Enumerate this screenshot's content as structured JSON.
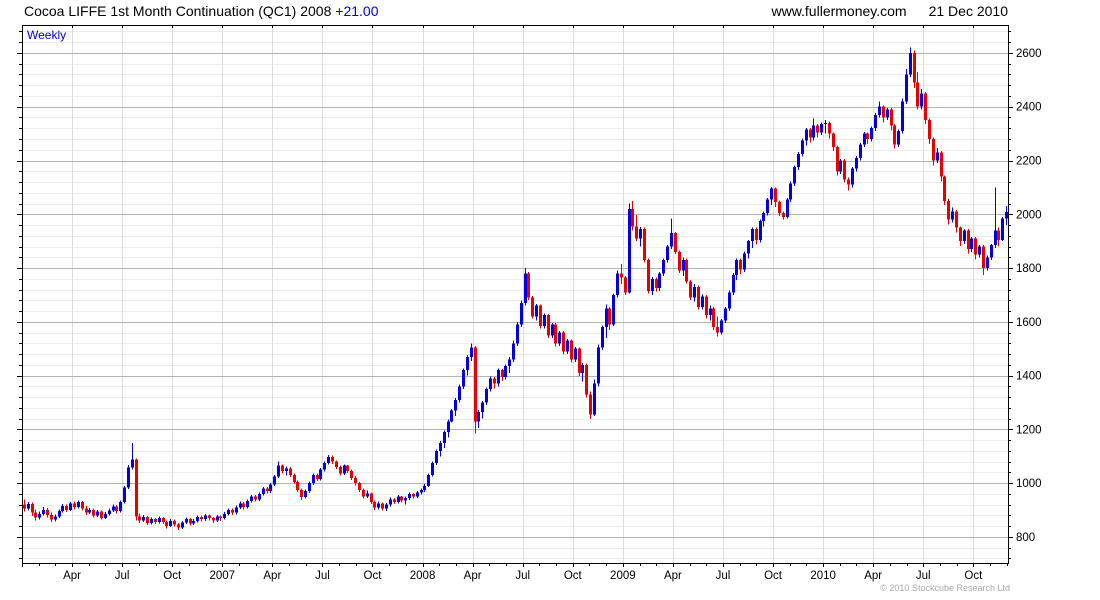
{
  "header": {
    "title": "Cocoa LIFFE 1st Month Continuation (QC1) 2008",
    "change": "+21.00",
    "change_color": "#0000cc",
    "website": "www.fullermoney.com",
    "date": "21 Dec 2010"
  },
  "chart": {
    "frequency_label": "Weekly",
    "footer_credit": "© 2010 Stockcube Research Ltd"
  },
  "chart_data": {
    "type": "candlestick",
    "instrument": "Cocoa LIFFE 1st Month Continuation (QC1)",
    "frequency": "Weekly",
    "last_price": 2008,
    "change": 21.0,
    "x_start": "Jan 2006",
    "x_end": "Dec 2010",
    "x_tick_labels": [
      "Apr",
      "Jul",
      "Oct",
      "2007",
      "Apr",
      "Jul",
      "Oct",
      "2008",
      "Apr",
      "Jul",
      "Oct",
      "2009",
      "Apr",
      "Jul",
      "Oct",
      "2010",
      "Apr",
      "Jul",
      "Oct"
    ],
    "x_tick_weeks": [
      13,
      26,
      39,
      52,
      65,
      78,
      91,
      104,
      117,
      130,
      143,
      156,
      169,
      182,
      195,
      208,
      221,
      234,
      247
    ],
    "weeks_per_month": 4.3333,
    "y_tick_values": [
      800,
      1000,
      1200,
      1400,
      1600,
      1800,
      2000,
      2200,
      2400,
      2600
    ],
    "y_minor_step": 40,
    "ylim": [
      703,
      2704
    ],
    "grid": {
      "major_color": "#b3b3b3",
      "minor_color": "#ececec",
      "vertical_color": "#dcdcdc"
    },
    "up_color": "#0000e0",
    "down_color": "#e60000",
    "ohlc": [
      [
        920,
        940,
        895,
        905
      ],
      [
        905,
        930,
        898,
        922
      ],
      [
        922,
        928,
        878,
        890
      ],
      [
        890,
        902,
        862,
        872
      ],
      [
        872,
        895,
        865,
        886
      ],
      [
        886,
        912,
        880,
        900
      ],
      [
        900,
        908,
        872,
        881
      ],
      [
        881,
        890,
        855,
        864
      ],
      [
        864,
        884,
        858,
        876
      ],
      [
        876,
        902,
        870,
        896
      ],
      [
        896,
        922,
        890,
        915
      ],
      [
        915,
        920,
        892,
        901
      ],
      [
        901,
        930,
        896,
        924
      ],
      [
        924,
        932,
        902,
        911
      ],
      [
        911,
        936,
        905,
        929
      ],
      [
        929,
        934,
        898,
        906
      ],
      [
        906,
        915,
        882,
        891
      ],
      [
        891,
        908,
        885,
        901
      ],
      [
        901,
        906,
        872,
        880
      ],
      [
        880,
        900,
        874,
        895
      ],
      [
        895,
        898,
        864,
        871
      ],
      [
        871,
        892,
        866,
        886
      ],
      [
        886,
        906,
        880,
        899
      ],
      [
        899,
        920,
        893,
        914
      ],
      [
        914,
        918,
        888,
        896
      ],
      [
        896,
        935,
        890,
        929
      ],
      [
        929,
        990,
        925,
        984
      ],
      [
        984,
        1068,
        978,
        1058
      ],
      [
        1058,
        1150,
        1050,
        1088
      ],
      [
        1088,
        1092,
        862,
        876
      ],
      [
        876,
        888,
        852,
        861
      ],
      [
        861,
        882,
        855,
        874
      ],
      [
        874,
        878,
        844,
        852
      ],
      [
        852,
        872,
        846,
        866
      ],
      [
        866,
        870,
        848,
        856
      ],
      [
        856,
        876,
        850,
        870
      ],
      [
        870,
        874,
        848,
        855
      ],
      [
        855,
        862,
        832,
        841
      ],
      [
        841,
        866,
        836,
        860
      ],
      [
        860,
        864,
        838,
        846
      ],
      [
        846,
        852,
        826,
        835
      ],
      [
        835,
        860,
        830,
        854
      ],
      [
        854,
        872,
        848,
        866
      ],
      [
        866,
        870,
        842,
        850
      ],
      [
        850,
        866,
        844,
        860
      ],
      [
        860,
        880,
        854,
        875
      ],
      [
        875,
        879,
        858,
        866
      ],
      [
        866,
        886,
        860,
        880
      ],
      [
        880,
        884,
        862,
        870
      ],
      [
        870,
        875,
        852,
        861
      ],
      [
        861,
        882,
        856,
        876
      ],
      [
        876,
        880,
        860,
        870
      ],
      [
        870,
        892,
        864,
        886
      ],
      [
        886,
        906,
        880,
        900
      ],
      [
        900,
        905,
        882,
        890
      ],
      [
        890,
        916,
        884,
        910
      ],
      [
        910,
        931,
        904,
        925
      ],
      [
        925,
        930,
        902,
        911
      ],
      [
        911,
        940,
        906,
        934
      ],
      [
        934,
        956,
        928,
        950
      ],
      [
        950,
        955,
        932,
        940
      ],
      [
        940,
        966,
        934,
        960
      ],
      [
        960,
        986,
        954,
        980
      ],
      [
        980,
        985,
        962,
        970
      ],
      [
        970,
        1000,
        964,
        995
      ],
      [
        995,
        1031,
        990,
        1025
      ],
      [
        1025,
        1080,
        1020,
        1065
      ],
      [
        1065,
        1070,
        1035,
        1045
      ],
      [
        1045,
        1061,
        1028,
        1055
      ],
      [
        1055,
        1060,
        1022,
        1030
      ],
      [
        1030,
        1036,
        998,
        1005
      ],
      [
        1005,
        1010,
        968,
        975
      ],
      [
        975,
        981,
        938,
        948
      ],
      [
        948,
        976,
        942,
        970
      ],
      [
        970,
        1006,
        964,
        1000
      ],
      [
        1000,
        1036,
        994,
        1030
      ],
      [
        1030,
        1035,
        1008,
        1015
      ],
      [
        1015,
        1056,
        1010,
        1050
      ],
      [
        1050,
        1081,
        1044,
        1075
      ],
      [
        1075,
        1105,
        1070,
        1098
      ],
      [
        1098,
        1102,
        1072,
        1080
      ],
      [
        1080,
        1085,
        1052,
        1060
      ],
      [
        1060,
        1066,
        1028,
        1035
      ],
      [
        1035,
        1070,
        1030,
        1065
      ],
      [
        1065,
        1068,
        1038,
        1045
      ],
      [
        1045,
        1050,
        1012,
        1020
      ],
      [
        1020,
        1026,
        992,
        1000
      ],
      [
        1000,
        1005,
        968,
        975
      ],
      [
        975,
        980,
        942,
        950
      ],
      [
        950,
        972,
        944,
        962
      ],
      [
        962,
        965,
        922,
        930
      ],
      [
        930,
        935,
        900,
        910
      ],
      [
        910,
        932,
        902,
        925
      ],
      [
        925,
        928,
        898,
        905
      ],
      [
        905,
        926,
        896,
        920
      ],
      [
        920,
        946,
        914,
        940
      ],
      [
        940,
        944,
        922,
        930
      ],
      [
        930,
        956,
        924,
        950
      ],
      [
        950,
        953,
        928,
        935
      ],
      [
        935,
        950,
        920,
        945
      ],
      [
        945,
        966,
        938,
        960
      ],
      [
        960,
        964,
        942,
        950
      ],
      [
        950,
        971,
        944,
        965
      ],
      [
        965,
        980,
        958,
        975
      ],
      [
        975,
        996,
        968,
        990
      ],
      [
        990,
        1036,
        985,
        1030
      ],
      [
        1030,
        1081,
        1024,
        1075
      ],
      [
        1075,
        1126,
        1068,
        1120
      ],
      [
        1120,
        1156,
        1100,
        1150
      ],
      [
        1150,
        1196,
        1130,
        1190
      ],
      [
        1190,
        1236,
        1170,
        1230
      ],
      [
        1230,
        1276,
        1225,
        1270
      ],
      [
        1270,
        1316,
        1250,
        1310
      ],
      [
        1310,
        1366,
        1300,
        1360
      ],
      [
        1360,
        1426,
        1350,
        1420
      ],
      [
        1420,
        1476,
        1400,
        1470
      ],
      [
        1470,
        1520,
        1455,
        1505
      ],
      [
        1505,
        1510,
        1185,
        1230
      ],
      [
        1230,
        1272,
        1205,
        1265
      ],
      [
        1265,
        1306,
        1240,
        1300
      ],
      [
        1300,
        1356,
        1290,
        1350
      ],
      [
        1350,
        1396,
        1340,
        1390
      ],
      [
        1390,
        1395,
        1352,
        1370
      ],
      [
        1370,
        1426,
        1360,
        1420
      ],
      [
        1420,
        1425,
        1380,
        1395
      ],
      [
        1395,
        1441,
        1385,
        1435
      ],
      [
        1435,
        1470,
        1410,
        1460
      ],
      [
        1460,
        1530,
        1450,
        1520
      ],
      [
        1520,
        1600,
        1510,
        1590
      ],
      [
        1590,
        1680,
        1580,
        1670
      ],
      [
        1670,
        1800,
        1660,
        1780
      ],
      [
        1780,
        1785,
        1682,
        1690
      ],
      [
        1690,
        1696,
        1612,
        1620
      ],
      [
        1620,
        1666,
        1605,
        1660
      ],
      [
        1660,
        1665,
        1575,
        1585
      ],
      [
        1585,
        1631,
        1575,
        1625
      ],
      [
        1625,
        1630,
        1540,
        1550
      ],
      [
        1550,
        1596,
        1540,
        1590
      ],
      [
        1590,
        1595,
        1508,
        1520
      ],
      [
        1520,
        1566,
        1510,
        1560
      ],
      [
        1560,
        1565,
        1478,
        1490
      ],
      [
        1490,
        1536,
        1480,
        1530
      ],
      [
        1530,
        1535,
        1448,
        1460
      ],
      [
        1460,
        1506,
        1450,
        1500
      ],
      [
        1500,
        1505,
        1398,
        1410
      ],
      [
        1410,
        1446,
        1378,
        1440
      ],
      [
        1440,
        1445,
        1318,
        1330
      ],
      [
        1330,
        1340,
        1238,
        1255
      ],
      [
        1255,
        1386,
        1250,
        1370
      ],
      [
        1370,
        1516,
        1360,
        1505
      ],
      [
        1505,
        1586,
        1495,
        1580
      ],
      [
        1580,
        1665,
        1540,
        1650
      ],
      [
        1650,
        1655,
        1570,
        1590
      ],
      [
        1590,
        1706,
        1585,
        1700
      ],
      [
        1700,
        1791,
        1690,
        1780
      ],
      [
        1780,
        1815,
        1740,
        1765
      ],
      [
        1765,
        1771,
        1700,
        1710
      ],
      [
        1710,
        2040,
        1705,
        2020
      ],
      [
        2020,
        2050,
        1940,
        1955
      ],
      [
        1955,
        1998,
        1900,
        1910
      ],
      [
        1910,
        1952,
        1880,
        1945
      ],
      [
        1945,
        1950,
        1820,
        1830
      ],
      [
        1830,
        1836,
        1705,
        1715
      ],
      [
        1715,
        1766,
        1700,
        1760
      ],
      [
        1760,
        1765,
        1712,
        1725
      ],
      [
        1725,
        1786,
        1715,
        1780
      ],
      [
        1780,
        1836,
        1770,
        1830
      ],
      [
        1830,
        1886,
        1820,
        1880
      ],
      [
        1880,
        1985,
        1870,
        1930
      ],
      [
        1930,
        1935,
        1852,
        1860
      ],
      [
        1860,
        1866,
        1782,
        1790
      ],
      [
        1790,
        1840,
        1770,
        1830
      ],
      [
        1830,
        1835,
        1742,
        1750
      ],
      [
        1750,
        1756,
        1682,
        1690
      ],
      [
        1690,
        1741,
        1675,
        1730
      ],
      [
        1730,
        1735,
        1645,
        1655
      ],
      [
        1655,
        1701,
        1645,
        1695
      ],
      [
        1695,
        1700,
        1612,
        1625
      ],
      [
        1625,
        1661,
        1605,
        1650
      ],
      [
        1650,
        1655,
        1570,
        1580
      ],
      [
        1580,
        1620,
        1545,
        1560
      ],
      [
        1560,
        1610,
        1552,
        1605
      ],
      [
        1605,
        1656,
        1595,
        1650
      ],
      [
        1650,
        1716,
        1640,
        1710
      ],
      [
        1710,
        1781,
        1700,
        1775
      ],
      [
        1775,
        1836,
        1755,
        1830
      ],
      [
        1830,
        1835,
        1777,
        1795
      ],
      [
        1795,
        1861,
        1785,
        1855
      ],
      [
        1855,
        1905,
        1835,
        1900
      ],
      [
        1900,
        1951,
        1875,
        1945
      ],
      [
        1945,
        1950,
        1887,
        1905
      ],
      [
        1905,
        1981,
        1895,
        1975
      ],
      [
        1975,
        2011,
        1955,
        2005
      ],
      [
        2005,
        2061,
        1995,
        2055
      ],
      [
        2055,
        2101,
        2035,
        2095
      ],
      [
        2095,
        2100,
        2027,
        2045
      ],
      [
        2045,
        2051,
        1993,
        2005
      ],
      [
        2005,
        2010,
        1980,
        1990
      ],
      [
        1990,
        2061,
        1985,
        2055
      ],
      [
        2055,
        2121,
        2045,
        2115
      ],
      [
        2115,
        2181,
        2105,
        2175
      ],
      [
        2175,
        2231,
        2165,
        2225
      ],
      [
        2225,
        2281,
        2215,
        2275
      ],
      [
        2275,
        2321,
        2255,
        2315
      ],
      [
        2315,
        2320,
        2267,
        2285
      ],
      [
        2285,
        2357,
        2275,
        2330
      ],
      [
        2330,
        2335,
        2285,
        2305
      ],
      [
        2305,
        2341,
        2295,
        2335
      ],
      [
        2335,
        2350,
        2300,
        2340
      ],
      [
        2340,
        2345,
        2282,
        2300
      ],
      [
        2300,
        2305,
        2235,
        2250
      ],
      [
        2250,
        2255,
        2145,
        2160
      ],
      [
        2160,
        2206,
        2150,
        2200
      ],
      [
        2200,
        2205,
        2118,
        2130
      ],
      [
        2130,
        2136,
        2088,
        2110
      ],
      [
        2110,
        2176,
        2100,
        2170
      ],
      [
        2170,
        2216,
        2160,
        2210
      ],
      [
        2210,
        2266,
        2200,
        2260
      ],
      [
        2260,
        2306,
        2250,
        2300
      ],
      [
        2300,
        2305,
        2262,
        2280
      ],
      [
        2280,
        2326,
        2270,
        2320
      ],
      [
        2320,
        2376,
        2310,
        2370
      ],
      [
        2370,
        2420,
        2360,
        2400
      ],
      [
        2400,
        2405,
        2342,
        2360
      ],
      [
        2360,
        2396,
        2350,
        2390
      ],
      [
        2390,
        2395,
        2312,
        2330
      ],
      [
        2330,
        2335,
        2245,
        2260
      ],
      [
        2260,
        2316,
        2250,
        2310
      ],
      [
        2310,
        2430,
        2300,
        2420
      ],
      [
        2420,
        2540,
        2410,
        2520
      ],
      [
        2520,
        2620,
        2510,
        2600
      ],
      [
        2600,
        2610,
        2470,
        2490
      ],
      [
        2490,
        2530,
        2390,
        2400
      ],
      [
        2400,
        2466,
        2390,
        2450
      ],
      [
        2450,
        2455,
        2335,
        2350
      ],
      [
        2350,
        2356,
        2262,
        2280
      ],
      [
        2280,
        2286,
        2182,
        2200
      ],
      [
        2200,
        2246,
        2190,
        2230
      ],
      [
        2230,
        2235,
        2122,
        2140
      ],
      [
        2140,
        2145,
        2035,
        2050
      ],
      [
        2050,
        2056,
        1962,
        1980
      ],
      [
        1980,
        2026,
        1970,
        2010
      ],
      [
        2010,
        2015,
        1932,
        1950
      ],
      [
        1950,
        1955,
        1882,
        1900
      ],
      [
        1900,
        1946,
        1890,
        1940
      ],
      [
        1940,
        1945,
        1855,
        1870
      ],
      [
        1870,
        1916,
        1860,
        1910
      ],
      [
        1910,
        1915,
        1832,
        1850
      ],
      [
        1850,
        1886,
        1840,
        1880
      ],
      [
        1880,
        1885,
        1775,
        1800
      ],
      [
        1800,
        1846,
        1790,
        1840
      ],
      [
        1840,
        1890,
        1830,
        1885
      ],
      [
        1885,
        2100,
        1875,
        1940
      ],
      [
        1940,
        1950,
        1880,
        1905
      ],
      [
        1905,
        1990,
        1900,
        1985
      ],
      [
        1985,
        2030,
        1960,
        2008
      ]
    ]
  }
}
